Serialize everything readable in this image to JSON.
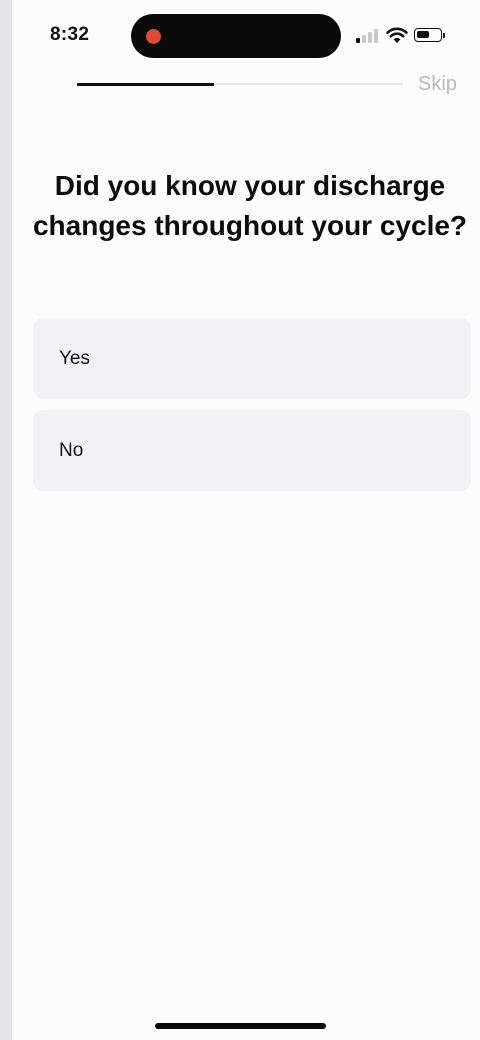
{
  "status_bar": {
    "time": "8:32",
    "signal_bars_active": 1,
    "signal_bars_total": 4,
    "battery_level": 0.55,
    "recording_color": "#e04a35"
  },
  "onboarding": {
    "progress": 0.42,
    "skip_label": "Skip",
    "question": "Did you know your discharge changes throughout your cycle?",
    "options": [
      {
        "label": "Yes"
      },
      {
        "label": "No"
      }
    ]
  },
  "icons": {
    "signal": "cellular-signal-icon",
    "wifi": "wifi-icon",
    "battery": "battery-icon"
  }
}
